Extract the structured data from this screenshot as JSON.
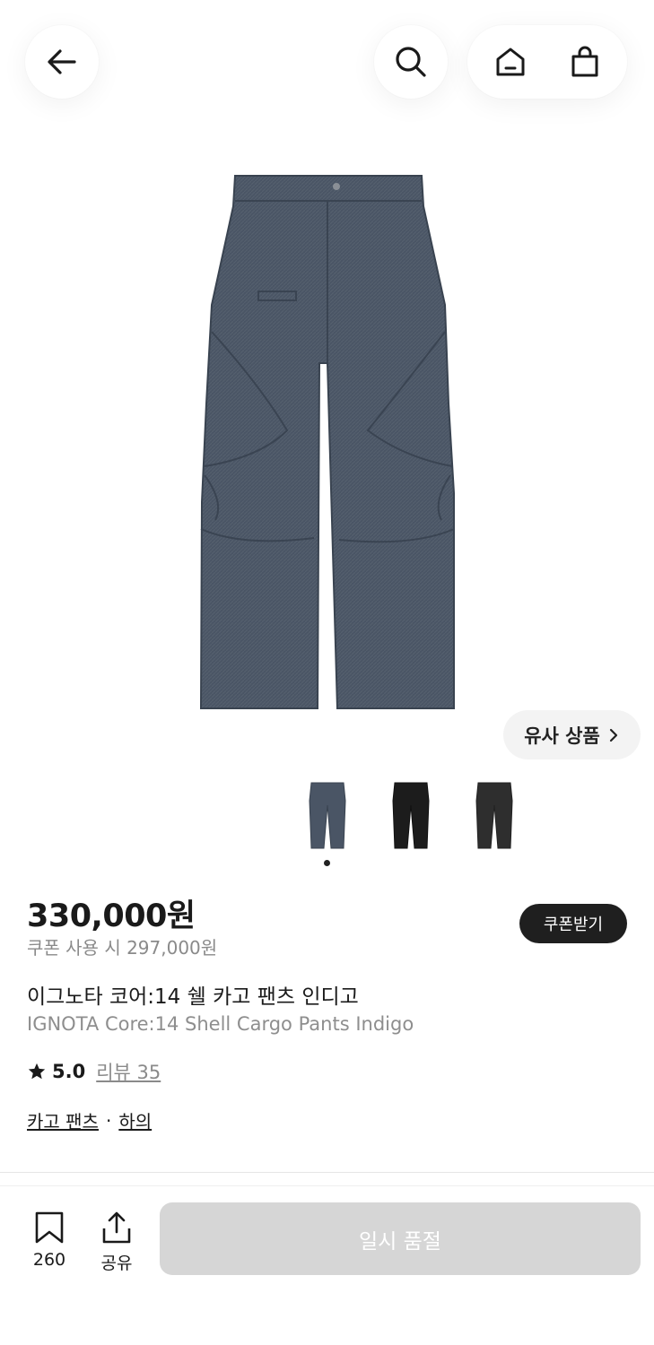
{
  "header": {
    "icons": [
      "arrow-left-icon",
      "search-icon",
      "home-icon",
      "shopping-bag-icon"
    ]
  },
  "gallery": {
    "similar_products_label": "유사 상품",
    "thumbnail_colors": [
      "#4a5565",
      "#1c1c1c",
      "#2e2e2e"
    ],
    "active_index": 0
  },
  "product": {
    "price": "330,000원",
    "coupon_price": "쿠폰 사용 시 297,000원",
    "coupon_button": "쿠폰받기",
    "name_ko": "이그노타 코어:14 쉘 카고 팬츠 인디고",
    "name_en": "IGNOTA Core:14 Shell Cargo Pants Indigo",
    "rating": "5.0",
    "review_label": "리뷰 35",
    "category": "카고 팬츠",
    "category_separator": "·",
    "subcategory": "하의"
  },
  "bottom_bar": {
    "bookmark_count": "260",
    "share_label": "공유",
    "action_label": "일시 품절"
  },
  "colors": {
    "denim": "#4a5565",
    "soldout_button": "#d6d6d6",
    "coupon_button": "#1f1f1f"
  }
}
